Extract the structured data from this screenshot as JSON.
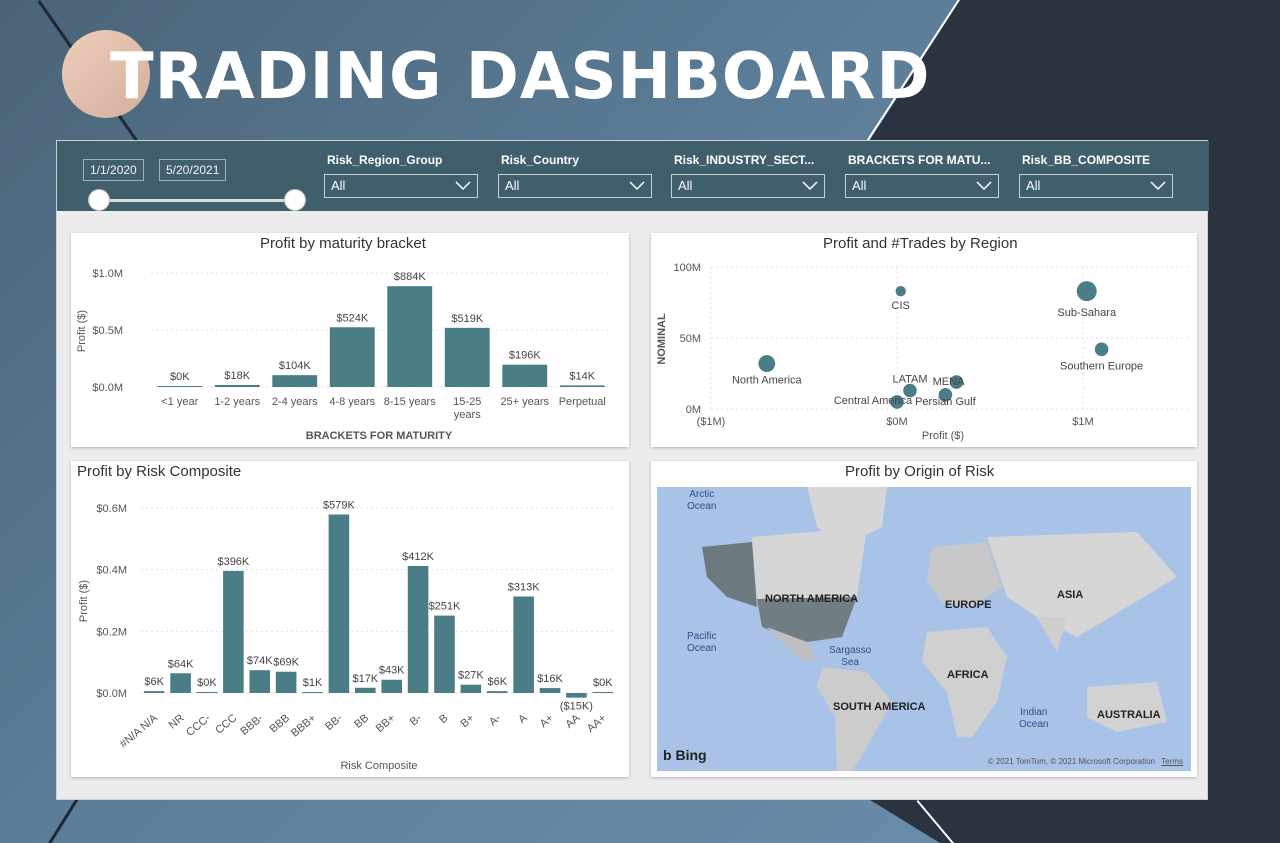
{
  "page": {
    "title": "TRADING DASHBOARD"
  },
  "filters": {
    "date_start": "1/1/2020",
    "date_end": "5/20/2021",
    "slicers": [
      {
        "label": "Risk_Region_Group",
        "value": "All"
      },
      {
        "label": "Risk_Country",
        "value": "All"
      },
      {
        "label": "Risk_INDUSTRY_SECT...",
        "value": "All"
      },
      {
        "label": "BRACKETS FOR MATU...",
        "value": "All"
      },
      {
        "label": "Risk_BB_COMPOSITE",
        "value": "All"
      }
    ]
  },
  "colors": {
    "bar": "#4b7d87",
    "filter_bg": "#3f5f6c",
    "map_water": "#a9c3e8"
  },
  "charts": {
    "maturity": {
      "title": "Profit by maturity bracket",
      "xlabel": "BRACKETS FOR MATURITY",
      "ylabel": "Profit ($)",
      "ticks": [
        "$0.0M",
        "$0.5M",
        "$1.0M"
      ]
    },
    "region": {
      "title": "Profit and #Trades by Region",
      "xlabel": "Profit ($)",
      "ylabel": "NOMINAL",
      "xticks": [
        "($1M)",
        "$0M",
        "$1M"
      ],
      "yticks": [
        "0M",
        "50M",
        "100M"
      ]
    },
    "composite": {
      "title": "Profit by Risk Composite",
      "xlabel": "Risk Composite",
      "ylabel": "Profit ($)",
      "ticks": [
        "$0.0M",
        "$0.2M",
        "$0.4M",
        "$0.6M"
      ]
    },
    "map": {
      "title": "Profit by Origin of Risk",
      "labels": {
        "arctic": "Arctic\nOcean",
        "pacific": "Pacific\nOcean",
        "sargasso": "Sargasso\nSea",
        "indian": "Indian\nOcean",
        "north_america": "NORTH AMERICA",
        "south_america": "SOUTH AMERICA",
        "europe": "EUROPE",
        "asia": "ASIA",
        "africa": "AFRICA",
        "australia": "AUSTRALIA"
      },
      "bing": "Bing",
      "copyright": "© 2021 TomTom, © 2021 Microsoft Corporation",
      "terms": "Terms"
    }
  },
  "chart_data": [
    {
      "type": "bar",
      "title": "Profit by maturity bracket",
      "xlabel": "BRACKETS FOR MATURITY",
      "ylabel": "Profit ($)",
      "ylim": [
        0,
        1.0
      ],
      "unit": "M",
      "categories": [
        "<1 year",
        "1-2 years",
        "2-4 years",
        "4-8 years",
        "8-15 years",
        "15-25 years",
        "25+ years",
        "Perpetual"
      ],
      "values": [
        0.0,
        0.018,
        0.104,
        0.524,
        0.884,
        0.519,
        0.196,
        0.014
      ],
      "data_labels": [
        "$0K",
        "$18K",
        "$104K",
        "$524K",
        "$884K",
        "$519K",
        "$196K",
        "$14K"
      ]
    },
    {
      "type": "scatter",
      "title": "Profit and #Trades by Region",
      "xlabel": "Profit ($)",
      "ylabel": "NOMINAL",
      "xlim": [
        -1,
        1
      ],
      "ylim": [
        0,
        100
      ],
      "points": [
        {
          "label": "CIS",
          "x": 0.02,
          "y": 83,
          "size": 2
        },
        {
          "label": "Sub-Sahara",
          "x": 1.02,
          "y": 83,
          "size": 5
        },
        {
          "label": "Southern Europe",
          "x": 1.1,
          "y": 42,
          "size": 3
        },
        {
          "label": "North America",
          "x": -0.7,
          "y": 32,
          "size": 4
        },
        {
          "label": "LATAM",
          "x": 0.07,
          "y": 13,
          "size": 3
        },
        {
          "label": "MENA",
          "x": 0.32,
          "y": 19,
          "size": 3
        },
        {
          "label": "Persian Gulf",
          "x": 0.26,
          "y": 10,
          "size": 3
        },
        {
          "label": "Central America",
          "x": 0.0,
          "y": 5,
          "size": 3
        }
      ]
    },
    {
      "type": "bar",
      "title": "Profit by Risk Composite",
      "xlabel": "Risk Composite",
      "ylabel": "Profit ($)",
      "ylim": [
        0,
        0.6
      ],
      "unit": "M",
      "categories": [
        "#N/A N/A",
        "NR",
        "CCC-",
        "CCC",
        "BBB-",
        "BBB",
        "BBB+",
        "BB-",
        "BB",
        "BB+",
        "B-",
        "B",
        "B+",
        "A-",
        "A",
        "A+",
        "AA",
        "AA+"
      ],
      "values": [
        0.006,
        0.064,
        0.0,
        0.396,
        0.074,
        0.069,
        0.001,
        0.579,
        0.017,
        0.043,
        0.412,
        0.251,
        0.027,
        0.006,
        0.313,
        0.016,
        -0.015,
        0.0
      ],
      "data_labels": [
        "$6K",
        "$64K",
        "$0K",
        "$396K",
        "$74K",
        "$69K",
        "$1K",
        "$579K",
        "$17K",
        "$43K",
        "$412K",
        "$251K",
        "$27K",
        "$6K",
        "$313K",
        "$16K",
        "($15K)",
        "$0K"
      ]
    }
  ]
}
